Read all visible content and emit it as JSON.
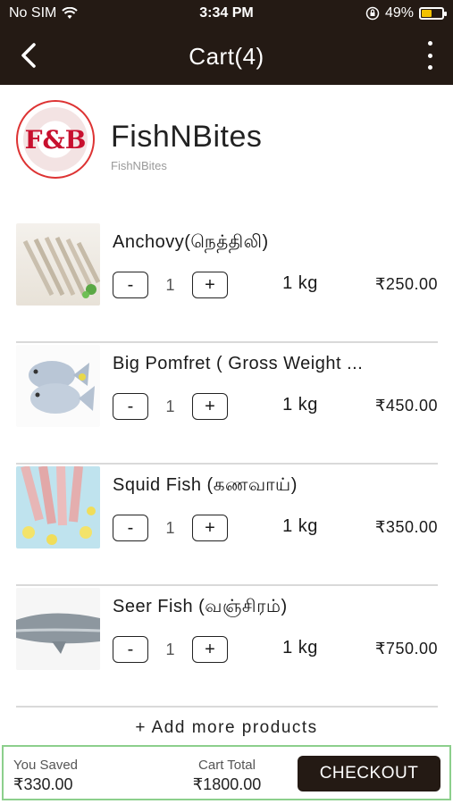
{
  "status_bar": {
    "carrier": "No SIM",
    "time": "3:34 PM",
    "battery": "49%",
    "battery_level": 0.49,
    "battery_color": "#f2c200"
  },
  "header": {
    "title": "Cart(4)",
    "back_icon": "chevron-left-icon",
    "menu_icon": "more-vertical-icon",
    "background": "#241a14"
  },
  "store": {
    "name": "FishNBites",
    "subtitle": "FishNBites",
    "logo_text": "F&B"
  },
  "items": [
    {
      "name": "Anchovy(நெத்திலி)",
      "qty": "1",
      "unit": "1 kg",
      "price": "₹250.00",
      "minus": "-",
      "plus": "+"
    },
    {
      "name": "Big Pomfret (  Gross Weight ...",
      "qty": "1",
      "unit": "1 kg",
      "price": "₹450.00",
      "minus": "-",
      "plus": "+"
    },
    {
      "name": "Squid Fish (கணவாய்)",
      "qty": "1",
      "unit": "1 kg",
      "price": "₹350.00",
      "minus": "-",
      "plus": "+"
    },
    {
      "name": "Seer Fish (வஞ்சிரம்)",
      "qty": "1",
      "unit": "1 kg",
      "price": "₹750.00",
      "minus": "-",
      "plus": "+"
    }
  ],
  "add_more": "+ Add more products",
  "footer": {
    "saved_label": "You Saved",
    "saved_value": "₹330.00",
    "total_label": "Cart Total",
    "total_value": "₹1800.00",
    "checkout_label": "CHECKOUT",
    "border_color": "#8ccf8c"
  }
}
